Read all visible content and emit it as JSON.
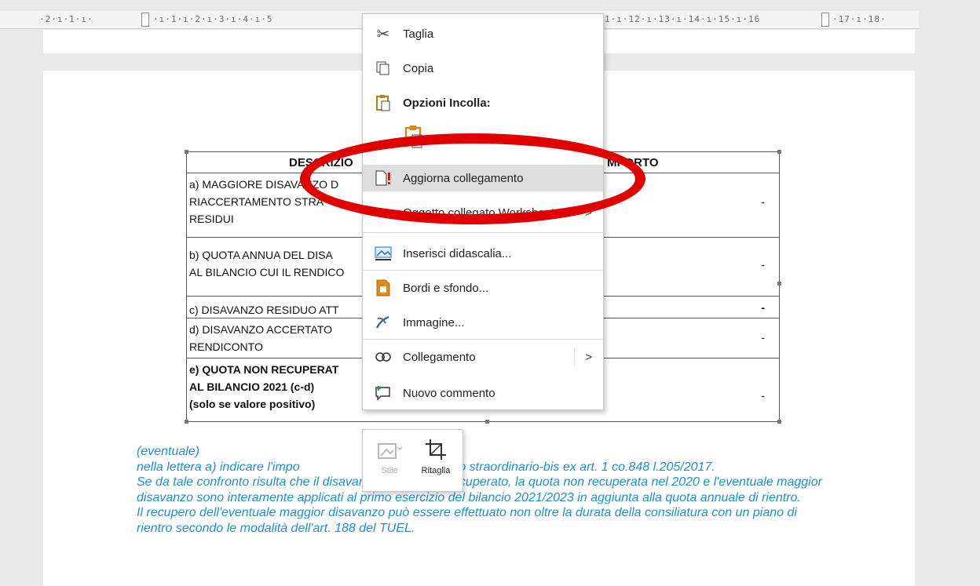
{
  "ruler": {
    "left_text": "·2·ı·1·ı·",
    "mid_text": "·ı·1·ı·2·ı·3·ı·4·ı·5",
    "right_text": "1·ı·12·ı·13·ı·14·ı·15·ı·16",
    "far_text": "·17·ı·18·"
  },
  "table": {
    "header_desc": "DESCRIZIO",
    "header_import": "MPORTO",
    "rows": [
      {
        "text": "a) MAGGIORE DISAVANZO D\nRIACCERTAMENTO STRA\nRESIDUI",
        "value": "-"
      },
      {
        "text": "b) QUOTA ANNUA DEL DISA\nAL BILANCIO CUI IL RENDICO",
        "value": "-"
      },
      {
        "text": "c) DISAVANZO RESIDUO ATT",
        "value": "-"
      },
      {
        "text": "d) DISAVANZO ACCERTATO\nRENDICONTO",
        "value": "-"
      },
      {
        "text": "e) QUOTA NON RECUPERAT\nAL BILANCIO 2021 (c-d)\n(solo se valore positivo)",
        "value": "-"
      }
    ]
  },
  "notes": [
    "(eventuale)",
    "nella lettera a) indicare l'impo                    la riaccertamento straordinario-bis ex art. 1 co.848 l.205/2017.",
    "Se da tale confronto risulta che il disavanzo non è stato recuperato, la quota non recuperata nel 2020 e l'eventuale maggior disavanzo sono interamente applicati al primo esercizio del bilancio 2021/2023 in aggiunta alla quota annuale di rientro.",
    "Il recupero dell'eventuale maggior disavanzo può essere effettuato non oltre la durata della consiliatura con un piano di rientro secondo le modalità dell'art. 188 del TUEL."
  ],
  "context_menu": {
    "cut": "Taglia",
    "copy": "Copia",
    "paste_options": "Opzioni Incolla:",
    "update_link": "Aggiorna collegamento",
    "linked_object": "Oggetto collegato Worksheet",
    "insert_caption": "Inserisci didascalia...",
    "borders": "Bordi e sfondo...",
    "image": "Immagine...",
    "link": "Collegamento",
    "new_comment": "Nuovo commento"
  },
  "mini_toolbar": {
    "style": "Stile",
    "crop": "Ritaglia"
  },
  "colors": {
    "highlight_oval": "#e00000",
    "note_text": "#1c8fd4"
  }
}
